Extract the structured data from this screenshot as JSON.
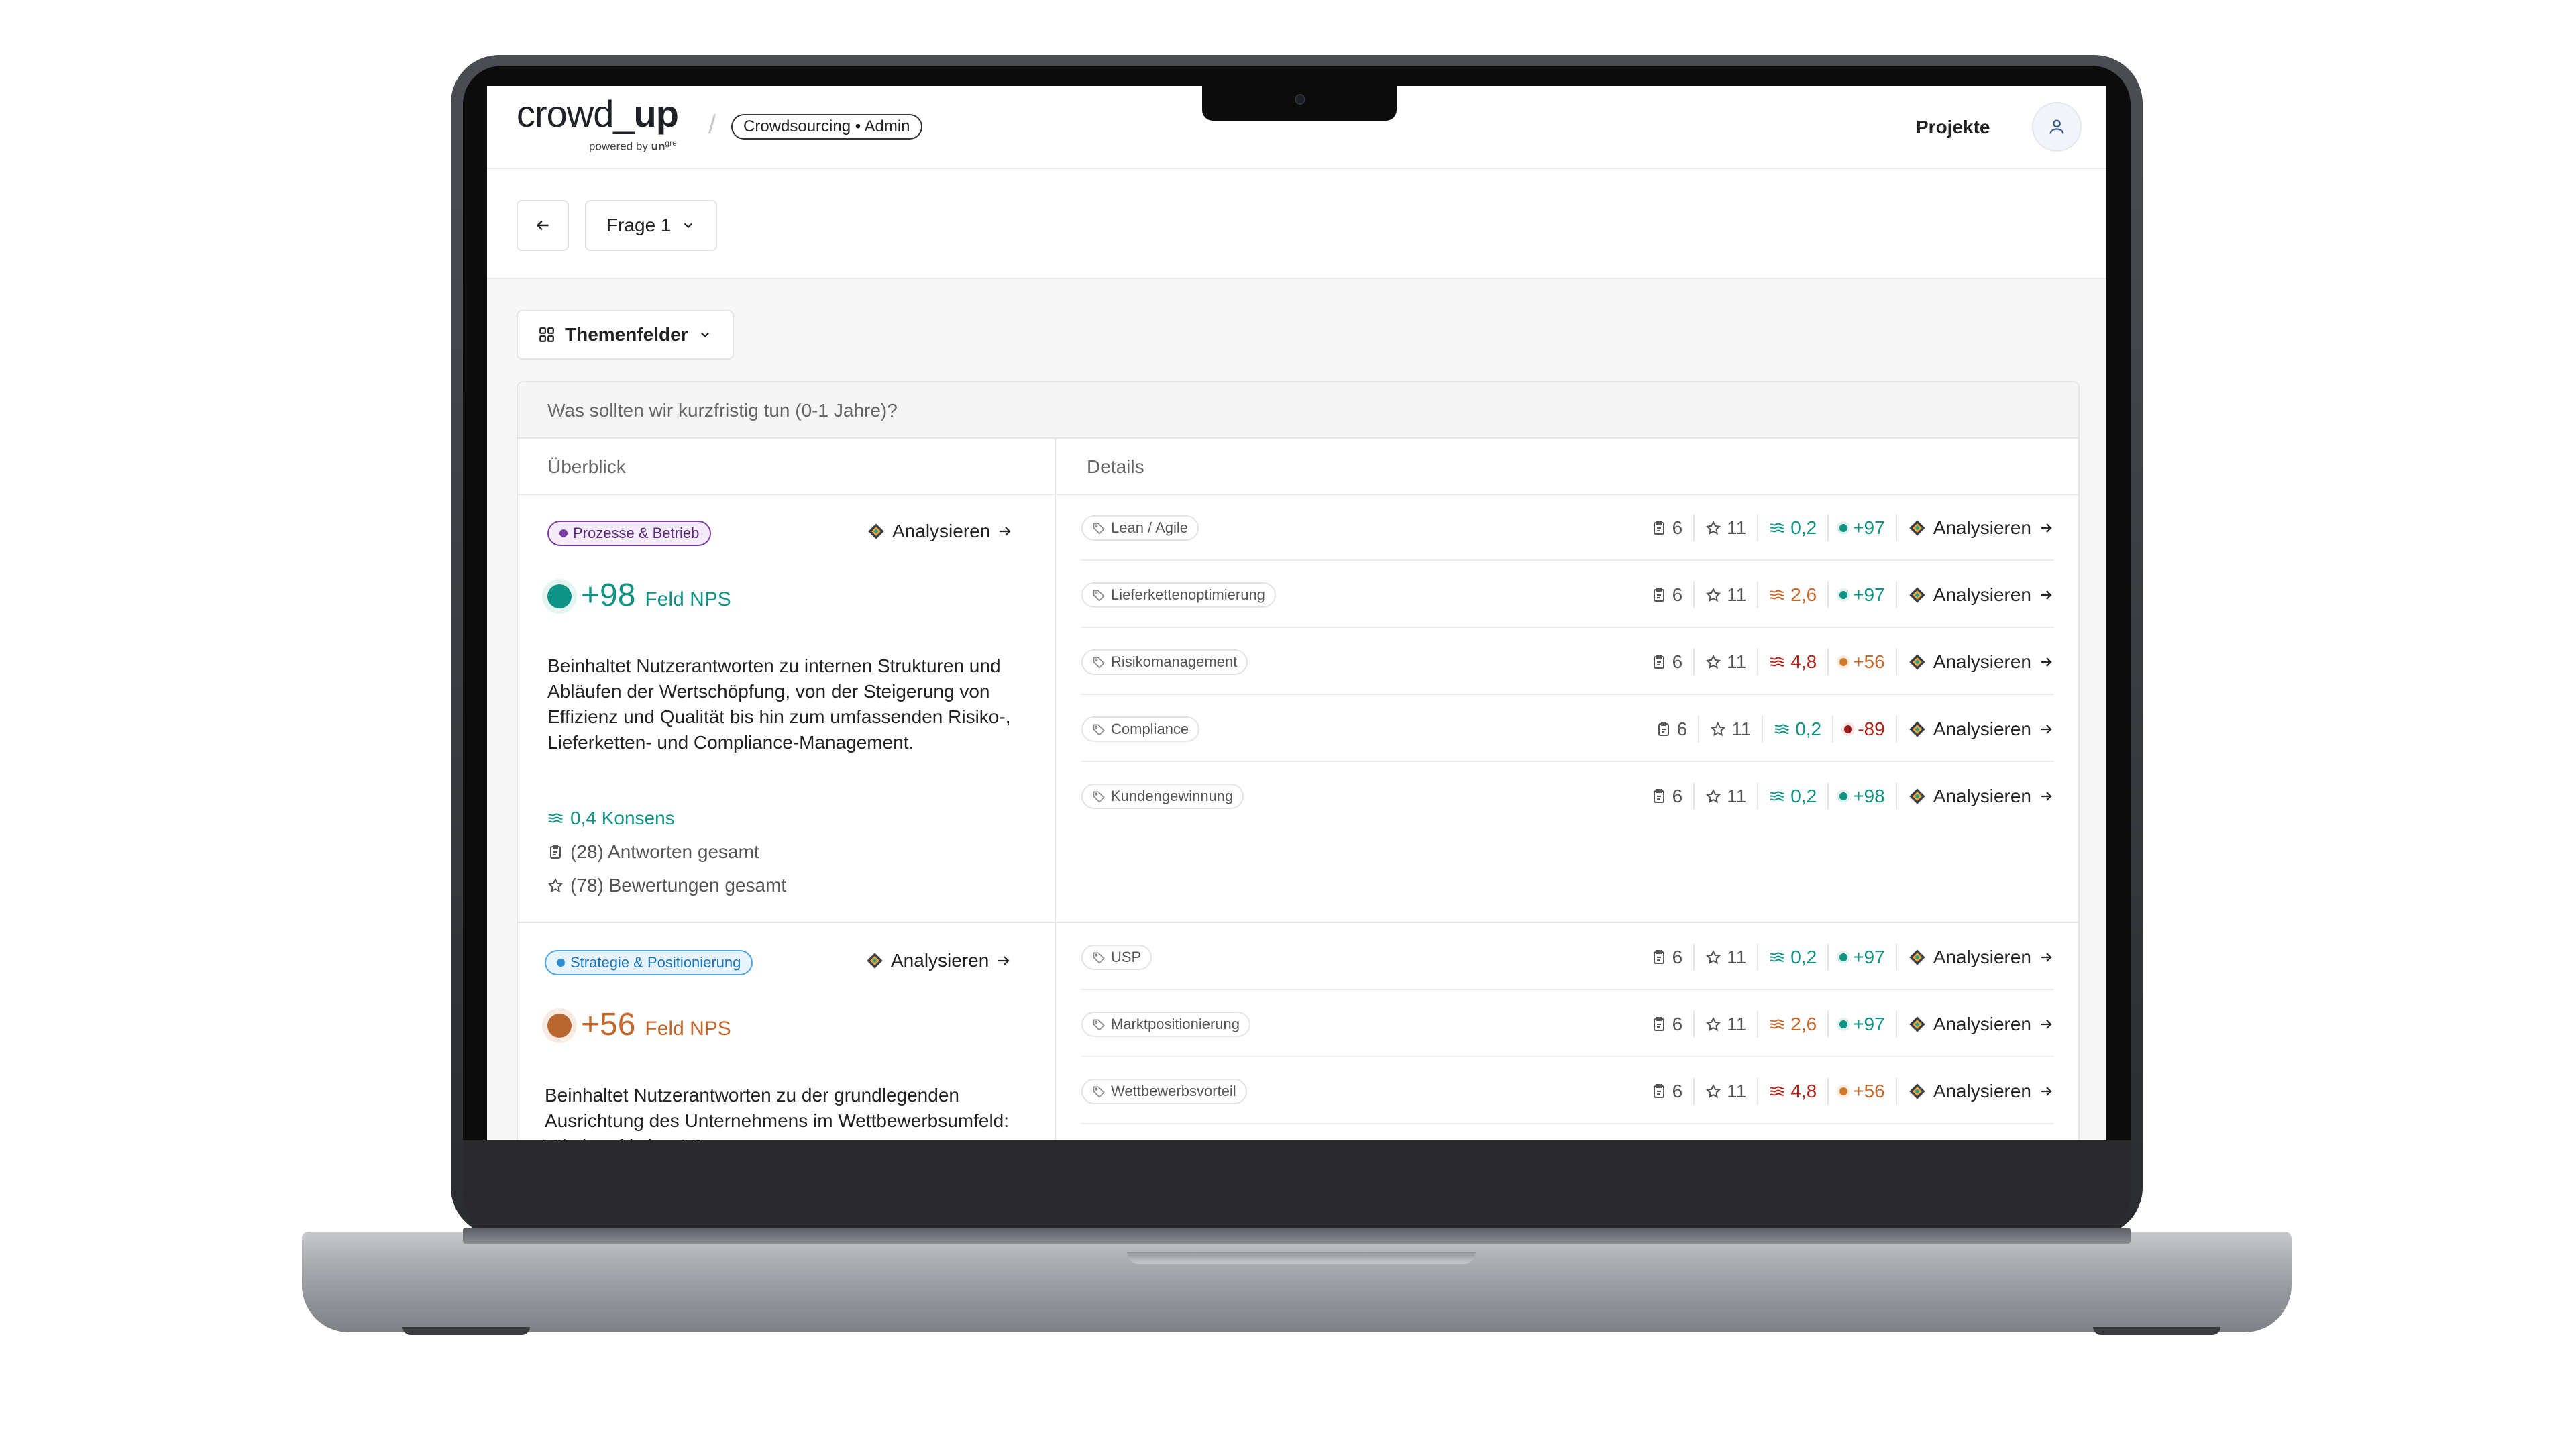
{
  "app": {
    "logo_main": "crowd_",
    "logo_bold": "up",
    "logo_powered": "powered by ",
    "logo_powered_brand": "un",
    "logo_powered_sup": "gre",
    "mode_badge": "Crowdsourcing • Admin",
    "nav_projects": "Projekte"
  },
  "toolbar": {
    "question_select": "Frage 1",
    "view_select": "Themenfelder"
  },
  "card": {
    "question": "Was sollten wir kurzfristig tun (0-1 Jahre)?",
    "col_overview": "Überblick",
    "col_details": "Details"
  },
  "colors": {
    "teal": "#0e9384",
    "orange": "#c4682c",
    "red": "#b42318",
    "purple_pill_bg": "#f4ebfa",
    "purple_pill_border": "#7b3fa0",
    "blue_pill_bg": "#e8f4fd",
    "blue_pill_border": "#4ea4e6"
  },
  "fields": [
    {
      "tag": "Prozesse & Betrieb",
      "analyse_label": "Analysieren",
      "nps": "+98",
      "nps_label": "Feld NPS",
      "description": "Beinhaltet Nutzerantworten zu internen Strukturen und Abläufen der Wertschöpfung, von der Steigerung von Effizienz und Qualität bis hin zum umfassenden Risiko-, Lieferketten- und Compliance-Management.",
      "consensus": "0,4 Konsens",
      "answers_total": "(28) Antworten gesamt",
      "ratings_total": "(78) Bewertungen gesamt",
      "topics": [
        {
          "name": "Lean / Agile",
          "answers": "6",
          "ratings": "11",
          "consensus": "0,2",
          "nps": "+97",
          "analyse": "Analysieren"
        },
        {
          "name": "Lieferkettenoptimierung",
          "answers": "6",
          "ratings": "11",
          "consensus": "2,6",
          "nps": "+97",
          "analyse": "Analysieren"
        },
        {
          "name": "Risikomanagement",
          "answers": "6",
          "ratings": "11",
          "consensus": "4,8",
          "nps": "+56",
          "analyse": "Analysieren"
        },
        {
          "name": "Compliance",
          "answers": "6",
          "ratings": "11",
          "consensus": "0,2",
          "nps": "-89",
          "analyse": "Analysieren"
        },
        {
          "name": "Kundengewinnung",
          "answers": "6",
          "ratings": "11",
          "consensus": "0,2",
          "nps": "+98",
          "analyse": "Analysieren"
        }
      ]
    },
    {
      "tag": "Strategie & Positionierung",
      "analyse_label": "Analysieren",
      "nps": "+56",
      "nps_label": "Feld NPS",
      "description": "Beinhaltet Nutzerantworten zu der grundlegenden Ausrichtung des Unternehmens im Wettbewerbsumfeld: Wie langfristiger Wert",
      "topics": [
        {
          "name": "USP",
          "answers": "6",
          "ratings": "11",
          "consensus": "0,2",
          "nps": "+97",
          "analyse": "Analysieren"
        },
        {
          "name": "Marktpositionierung",
          "answers": "6",
          "ratings": "11",
          "consensus": "2,6",
          "nps": "+97",
          "analyse": "Analysieren"
        },
        {
          "name": "Wettbewerbsvorteil",
          "answers": "6",
          "ratings": "11",
          "consensus": "4,8",
          "nps": "+56",
          "analyse": "Analysieren"
        }
      ]
    }
  ]
}
